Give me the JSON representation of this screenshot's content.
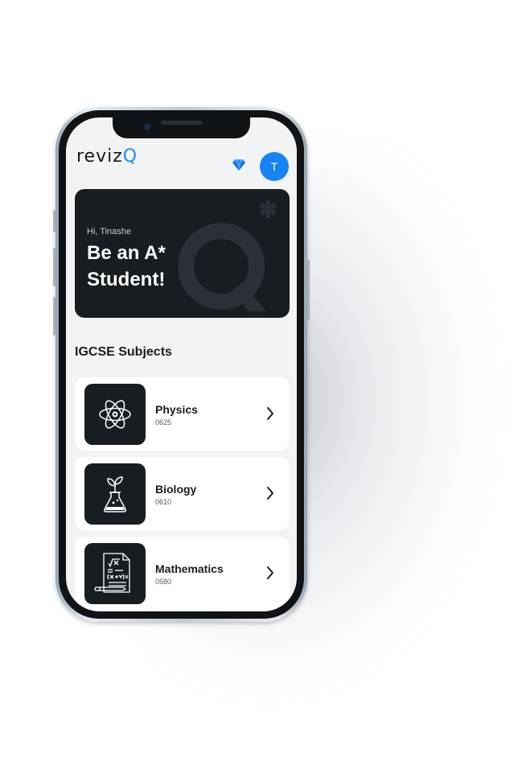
{
  "app": {
    "logo_text": "reviz",
    "logo_accent": "Q",
    "accent_color": "#1f8bff"
  },
  "header": {
    "avatar_initial": "T"
  },
  "hero": {
    "greeting": "Hi, Tinashe",
    "headline": "Be an A* Student!"
  },
  "section": {
    "title": "IGCSE Subjects"
  },
  "subjects": [
    {
      "name": "Physics",
      "code": "0625",
      "icon": "atom-icon"
    },
    {
      "name": "Biology",
      "code": "0610",
      "icon": "plant-flask-icon"
    },
    {
      "name": "Mathematics",
      "code": "0580",
      "icon": "math-paper-icon"
    }
  ]
}
